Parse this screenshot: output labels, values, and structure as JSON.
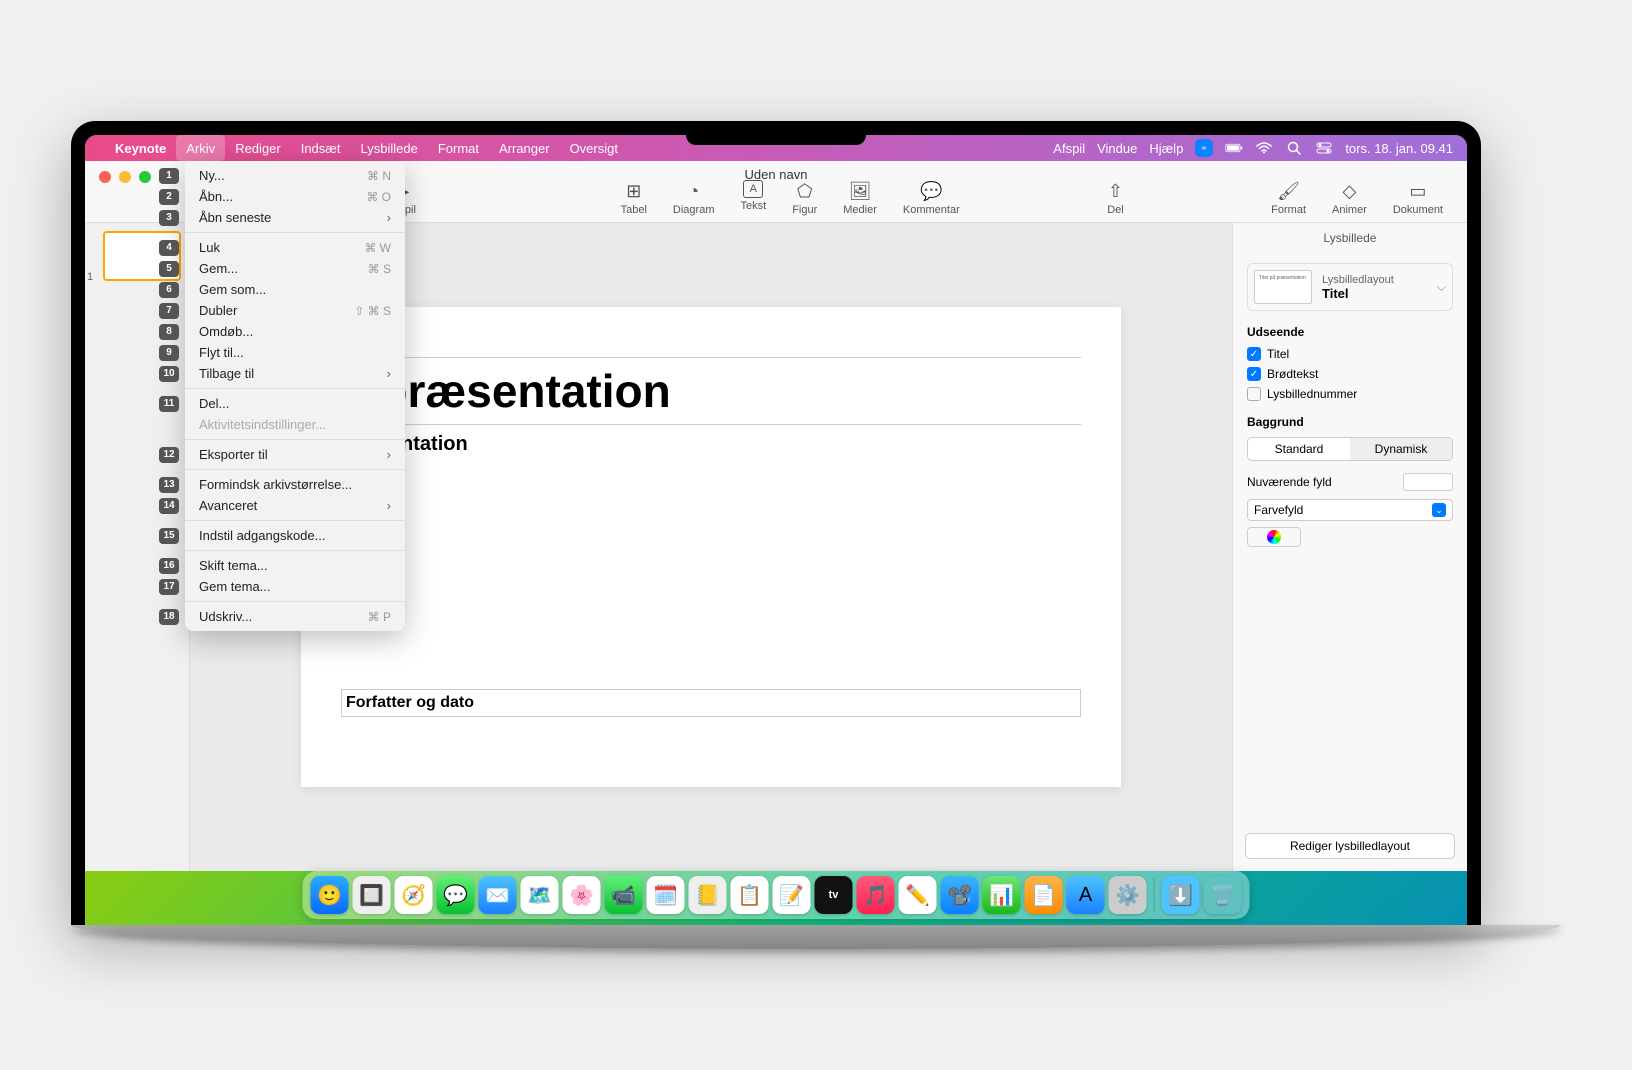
{
  "menubar": {
    "app": "Keynote",
    "items": [
      "Arkiv",
      "Rediger",
      "Indsæt",
      "Lysbillede",
      "Format",
      "Arranger",
      "Oversigt"
    ],
    "right_items": [
      "Afspil",
      "Vindue",
      "Hjælp"
    ],
    "datetime": "tors. 18. jan.  09.41"
  },
  "window": {
    "title": "Uden navn",
    "toolbar": {
      "play": "Afspil",
      "table": "Tabel",
      "chart": "Diagram",
      "text": "Tekst",
      "shape": "Figur",
      "media": "Medier",
      "comment": "Kommentar",
      "share": "Del",
      "format": "Format",
      "animate": "Animer",
      "document": "Dokument"
    }
  },
  "slide": {
    "number": "1",
    "title_visible": "å præsentation",
    "subtitle_visible": "præsentation",
    "author": "Forfatter og dato"
  },
  "inspector": {
    "title": "Lysbillede",
    "layout_label": "Lysbilledlayout",
    "layout_value": "Titel",
    "appearance": "Udseende",
    "chk_title": "Titel",
    "chk_body": "Brødtekst",
    "chk_number": "Lysbillednummer",
    "background": "Baggrund",
    "seg_standard": "Standard",
    "seg_dynamic": "Dynamisk",
    "current_fill": "Nuværende fyld",
    "fill_type": "Farvefyld",
    "edit_button": "Rediger lysbilledlayout"
  },
  "menu": {
    "items": [
      {
        "n": "1",
        "label": "Ny...",
        "sc": "⌘ N"
      },
      {
        "n": "2",
        "label": "Åbn...",
        "sc": "⌘ O"
      },
      {
        "n": "3",
        "label": "Åbn seneste",
        "sub": true
      },
      {
        "sep": true
      },
      {
        "n": "4",
        "label": "Luk",
        "sc": "⌘ W"
      },
      {
        "n": "5",
        "label": "Gem...",
        "sc": "⌘ S"
      },
      {
        "n": "6",
        "label": "Gem som..."
      },
      {
        "n": "7",
        "label": "Dubler",
        "sc": "⇧ ⌘ S"
      },
      {
        "n": "8",
        "label": "Omdøb..."
      },
      {
        "n": "9",
        "label": "Flyt til..."
      },
      {
        "n": "10",
        "label": "Tilbage til",
        "sub": true
      },
      {
        "sep": true
      },
      {
        "n": "11",
        "label": "Del..."
      },
      {
        "label": "Aktivitetsindstillinger...",
        "disabled": true
      },
      {
        "sep": true
      },
      {
        "n": "12",
        "label": "Eksporter til",
        "sub": true
      },
      {
        "sep": true
      },
      {
        "n": "13",
        "label": "Formindsk arkivstørrelse..."
      },
      {
        "n": "14",
        "label": "Avanceret",
        "sub": true
      },
      {
        "sep": true
      },
      {
        "n": "15",
        "label": "Indstil adgangskode..."
      },
      {
        "sep": true
      },
      {
        "n": "16",
        "label": "Skift tema..."
      },
      {
        "n": "17",
        "label": "Gem tema..."
      },
      {
        "sep": true
      },
      {
        "n": "18",
        "label": "Udskriv...",
        "sc": "⌘ P"
      }
    ]
  },
  "dock": {
    "icons": [
      {
        "name": "finder",
        "bg": "linear-gradient(#29abff,#0a6bff)",
        "emoji": "🙂"
      },
      {
        "name": "launchpad",
        "bg": "#eee",
        "emoji": "🔲"
      },
      {
        "name": "safari",
        "bg": "#fff",
        "emoji": "🧭"
      },
      {
        "name": "messages",
        "bg": "linear-gradient(#5ff075,#09c033)",
        "emoji": "💬"
      },
      {
        "name": "mail",
        "bg": "linear-gradient(#4fc3ff,#1a7fff)",
        "emoji": "✉️"
      },
      {
        "name": "maps",
        "bg": "#fff",
        "emoji": "🗺️"
      },
      {
        "name": "photos",
        "bg": "#fff",
        "emoji": "🌸"
      },
      {
        "name": "facetime",
        "bg": "linear-gradient(#5ff075,#09c033)",
        "emoji": "📹"
      },
      {
        "name": "calendar",
        "bg": "#fff",
        "emoji": "🗓️"
      },
      {
        "name": "contacts",
        "bg": "#eee",
        "emoji": "📒"
      },
      {
        "name": "reminders",
        "bg": "#fff",
        "emoji": "📋"
      },
      {
        "name": "notes",
        "bg": "#fff",
        "emoji": "📝"
      },
      {
        "name": "tv",
        "bg": "#111",
        "emoji": "tv"
      },
      {
        "name": "music",
        "bg": "linear-gradient(#ff5a7a,#ff2050)",
        "emoji": "🎵"
      },
      {
        "name": "freeform",
        "bg": "#fff",
        "emoji": "✏️"
      },
      {
        "name": "keynote",
        "bg": "linear-gradient(#3cb4ff,#0a7fff)",
        "emoji": "📽️"
      },
      {
        "name": "numbers",
        "bg": "linear-gradient(#71e571,#18b818)",
        "emoji": "📊"
      },
      {
        "name": "pages",
        "bg": "linear-gradient(#ffb347,#ff8a00)",
        "emoji": "📄"
      },
      {
        "name": "appstore",
        "bg": "linear-gradient(#4fc3ff,#1a7fff)",
        "emoji": "A"
      },
      {
        "name": "settings",
        "bg": "#ccc",
        "emoji": "⚙️"
      }
    ],
    "extra": [
      {
        "name": "downloads",
        "bg": "#4fc3ff",
        "emoji": "⬇️"
      },
      {
        "name": "trash",
        "bg": "transparent",
        "emoji": "🗑️"
      }
    ]
  }
}
